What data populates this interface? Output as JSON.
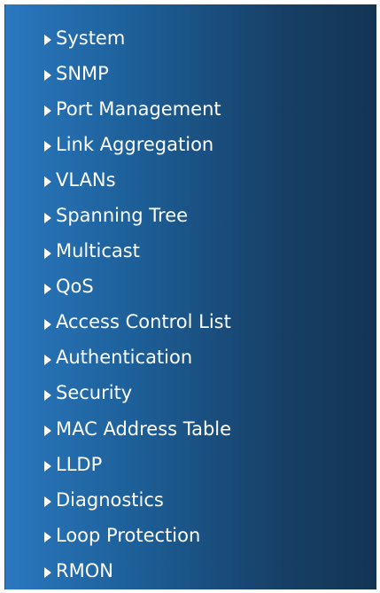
{
  "nav": {
    "items": [
      {
        "label": "System"
      },
      {
        "label": "SNMP"
      },
      {
        "label": "Port Management"
      },
      {
        "label": "Link Aggregation"
      },
      {
        "label": "VLANs"
      },
      {
        "label": "Spanning Tree"
      },
      {
        "label": "Multicast"
      },
      {
        "label": "QoS"
      },
      {
        "label": "Access Control List"
      },
      {
        "label": "Authentication"
      },
      {
        "label": "Security"
      },
      {
        "label": "MAC Address Table"
      },
      {
        "label": "LLDP"
      },
      {
        "label": "Diagnostics"
      },
      {
        "label": "Loop Protection"
      },
      {
        "label": "RMON"
      }
    ],
    "item_icon": "triangle-right-icon",
    "colors": {
      "text": "#ffffff",
      "panel_gradient_start": "#2a78bf",
      "panel_gradient_end": "#133554"
    }
  }
}
